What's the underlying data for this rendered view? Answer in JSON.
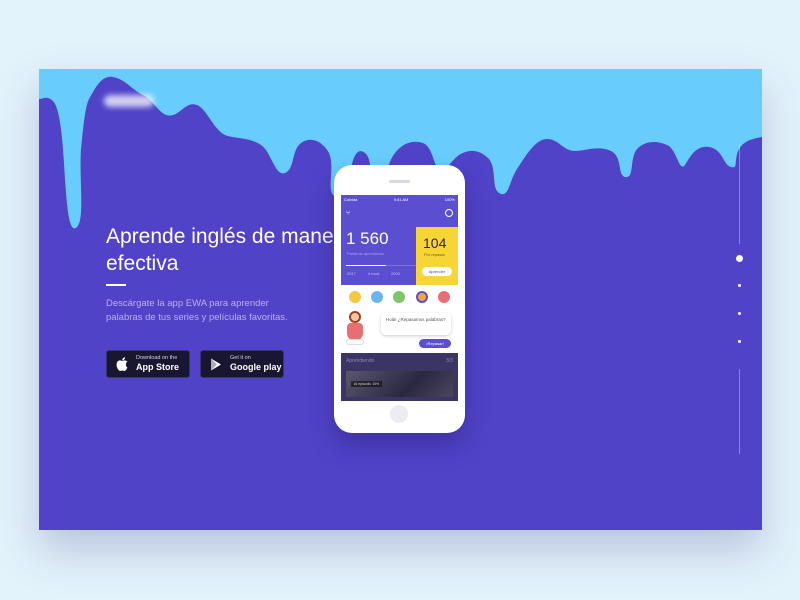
{
  "hero": {
    "headline": "Aprende inglés de manera efectiva",
    "subtitle": "Descárgate la app EWA para aprender palabras de tus series y películas favoritas."
  },
  "store_buttons": {
    "appstore": {
      "small": "Download on the",
      "big": "App Store"
    },
    "googleplay": {
      "small": "Get it on",
      "big": "Google play"
    }
  },
  "phone": {
    "status": {
      "carrier": "Culvida",
      "time": "9:41 AM",
      "battery": "100%"
    },
    "words_count": "1 560",
    "words_label": "Palabras aprendidas",
    "tabs": [
      "2017",
      "4 mod",
      "2000"
    ],
    "yellow_count": "104",
    "yellow_label": "Por repasar",
    "yellow_button": "Aprender",
    "chat_text": "Hola! ¿Repasamos palabras?",
    "chat_button": "¡Repasar!",
    "learning_title": "Aprendiendo",
    "learning_count": "3/3",
    "learning_item": "Al episodio 15%"
  },
  "colors": {
    "background": "#e3f3fb",
    "card": "#5043c8",
    "drip": "#68cdfd",
    "yellow": "#f6d534"
  },
  "nav": {
    "active_index": 0,
    "dot_count": 4
  }
}
